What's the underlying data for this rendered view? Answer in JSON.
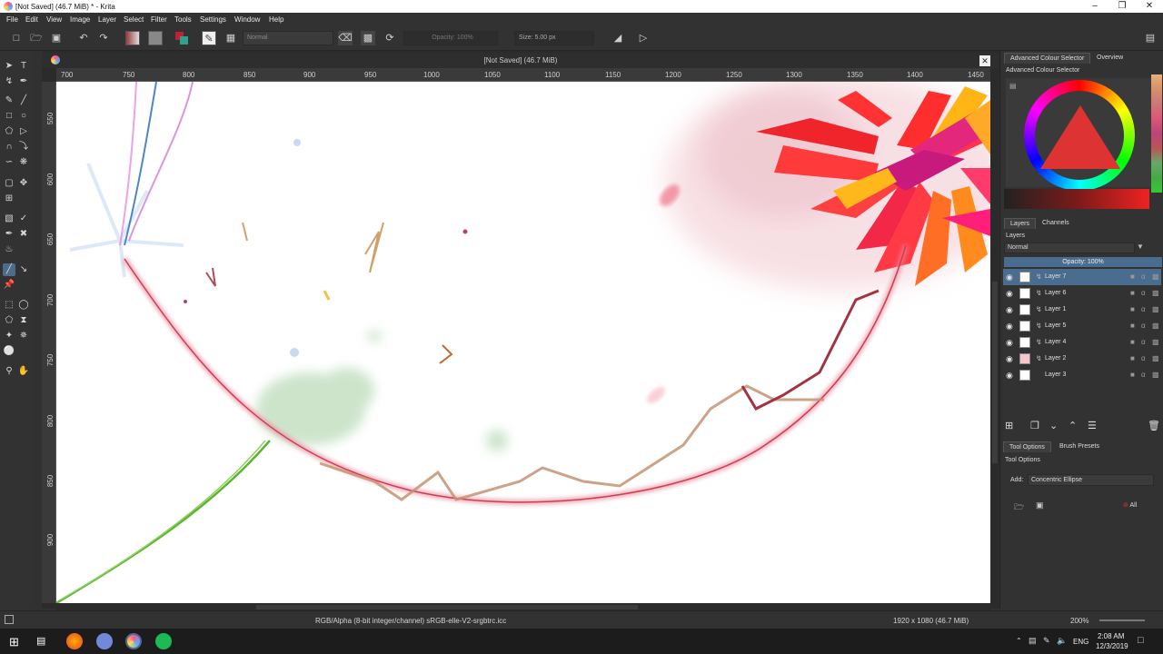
{
  "window": {
    "title": "[Not Saved]  (46.7 MiB) * - Krita",
    "min_icon": "minimize-icon",
    "max_icon": "maximize-icon",
    "close_icon": "close-icon"
  },
  "menu": [
    "File",
    "Edit",
    "View",
    "Image",
    "Layer",
    "Select",
    "Filter",
    "Tools",
    "Settings",
    "Window",
    "Help"
  ],
  "toolbar": {
    "blend_mode": "Normal",
    "opacity_label": "Opacity:  100%",
    "size_label": "Size:  5.00 px"
  },
  "document": {
    "tab_title": "[Not Saved]  (46.7 MiB)"
  },
  "ruler": {
    "h": [
      "700",
      "750",
      "800",
      "850",
      "900",
      "950",
      "1000",
      "1050",
      "1100",
      "1150",
      "1200",
      "1250",
      "1300",
      "1350",
      "1400",
      "1450"
    ],
    "v": [
      "550",
      "600",
      "650",
      "700",
      "750",
      "800",
      "850",
      "900"
    ]
  },
  "color_selector": {
    "tab": "Advanced Colour Selector",
    "tab2": "Overview",
    "title": "Advanced Colour Selector"
  },
  "layers_panel": {
    "tab": "Layers",
    "tab2": "Channels",
    "title": "Layers",
    "blend": "Normal",
    "opacity": "Opacity:  100%",
    "layers": [
      {
        "name": "Layer 7",
        "selected": true
      },
      {
        "name": "Layer 6",
        "selected": false
      },
      {
        "name": "Layer 1",
        "selected": false
      },
      {
        "name": "Layer 5",
        "selected": false
      },
      {
        "name": "Layer 4",
        "selected": false
      },
      {
        "name": "Layer 2",
        "selected": false
      },
      {
        "name": "Layer 3",
        "selected": false
      }
    ]
  },
  "tool_options": {
    "tab": "Tool Options",
    "tab2": "Brush Presets",
    "title": "Tool Options",
    "add_label": "Add:",
    "add_value": "Concentric Ellipse",
    "all_label": "All"
  },
  "status": {
    "color_info": "RGB/Alpha (8-bit integer/channel)  sRGB-elle-V2-srgbtrc.icc",
    "dimensions": "1920 x 1080 (46.7 MiB)",
    "zoom": "200%"
  },
  "taskbar": {
    "lang": "ENG",
    "time": "2:08 AM",
    "date": "12/3/2019"
  },
  "colors": {
    "accent": "#4a6d8f",
    "panel": "#323232",
    "canvas": "#ffffff"
  }
}
